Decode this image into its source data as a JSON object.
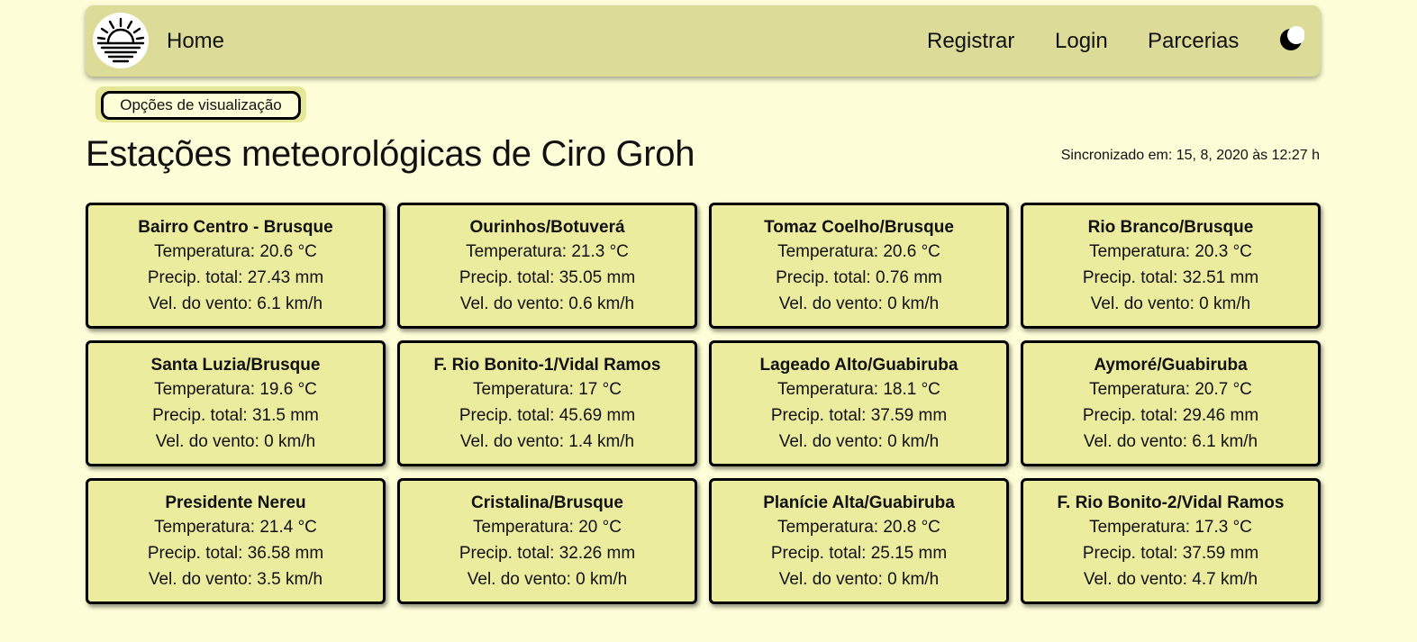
{
  "nav": {
    "home": "Home",
    "registrar": "Registrar",
    "login": "Login",
    "parcerias": "Parcerias"
  },
  "icons": {
    "logo": "sunrise-logo-icon",
    "theme_toggle": "moon-icon"
  },
  "colors": {
    "background": "#fdfdd8",
    "navbar": "#dcdc98",
    "card": "#ecec9e"
  },
  "view_options_label": "Opções de visualização",
  "page_title": "Estações meteorológicas de Ciro Groh",
  "sync_text": "Sincronizado em: 15, 8, 2020 às 12:27 h",
  "stations": [
    {
      "name": "Bairro Centro - Brusque",
      "temp": "Temperatura: 20.6 °C",
      "precip": "Precip. total: 27.43 mm",
      "wind": "Vel. do vento: 6.1 km/h"
    },
    {
      "name": "Ourinhos/Botuverá",
      "temp": "Temperatura: 21.3 °C",
      "precip": "Precip. total: 35.05 mm",
      "wind": "Vel. do vento: 0.6 km/h"
    },
    {
      "name": "Tomaz Coelho/Brusque",
      "temp": "Temperatura: 20.6 °C",
      "precip": "Precip. total: 0.76 mm",
      "wind": "Vel. do vento: 0 km/h"
    },
    {
      "name": "Rio Branco/Brusque",
      "temp": "Temperatura: 20.3 °C",
      "precip": "Precip. total: 32.51 mm",
      "wind": "Vel. do vento: 0 km/h"
    },
    {
      "name": "Santa Luzia/Brusque",
      "temp": "Temperatura: 19.6 °C",
      "precip": "Precip. total: 31.5 mm",
      "wind": "Vel. do vento: 0 km/h"
    },
    {
      "name": "F. Rio Bonito-1/Vidal Ramos",
      "temp": "Temperatura: 17 °C",
      "precip": "Precip. total: 45.69 mm",
      "wind": "Vel. do vento: 1.4 km/h"
    },
    {
      "name": "Lageado Alto/Guabiruba",
      "temp": "Temperatura: 18.1 °C",
      "precip": "Precip. total: 37.59 mm",
      "wind": "Vel. do vento: 0 km/h"
    },
    {
      "name": "Aymoré/Guabiruba",
      "temp": "Temperatura: 20.7 °C",
      "precip": "Precip. total: 29.46 mm",
      "wind": "Vel. do vento: 6.1 km/h"
    },
    {
      "name": "Presidente Nereu",
      "temp": "Temperatura: 21.4 °C",
      "precip": "Precip. total: 36.58 mm",
      "wind": "Vel. do vento: 3.5 km/h"
    },
    {
      "name": "Cristalina/Brusque",
      "temp": "Temperatura: 20 °C",
      "precip": "Precip. total: 32.26 mm",
      "wind": "Vel. do vento: 0 km/h"
    },
    {
      "name": "Planície Alta/Guabiruba",
      "temp": "Temperatura: 20.8 °C",
      "precip": "Precip. total: 25.15 mm",
      "wind": "Vel. do vento: 0 km/h"
    },
    {
      "name": "F. Rio Bonito-2/Vidal Ramos",
      "temp": "Temperatura: 17.3 °C",
      "precip": "Precip. total: 37.59 mm",
      "wind": "Vel. do vento: 4.7 km/h"
    }
  ]
}
